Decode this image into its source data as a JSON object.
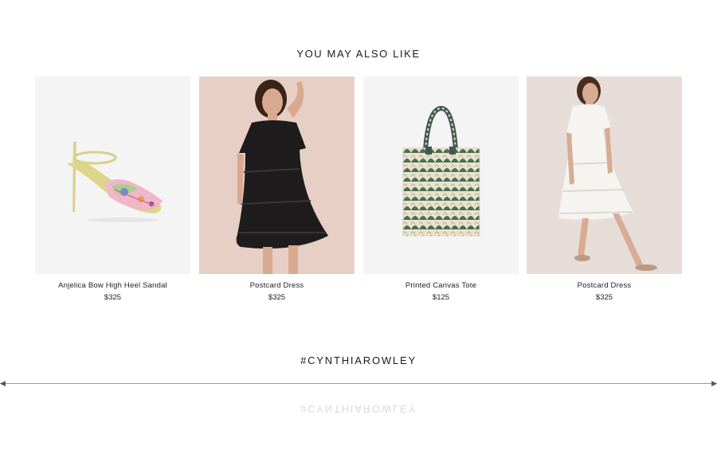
{
  "section": {
    "title": "YOU MAY ALSO LIKE"
  },
  "products": [
    {
      "name": "Anjelica Bow High Heel Sandal",
      "price": "$325",
      "image": "sandal"
    },
    {
      "name": "Postcard Dress",
      "price": "$325",
      "image": "black-dress"
    },
    {
      "name": "Printed Canvas Tote",
      "price": "$125",
      "image": "tote-bag"
    },
    {
      "name": "Postcard Dress",
      "price": "$325",
      "image": "white-dress"
    }
  ],
  "instagram": {
    "hashtag": "#CYNTHIAROWLEY"
  },
  "colors": {
    "image_bg_light": "#f5f5f5",
    "image_bg_pink": "#e6ccc2",
    "text": "#222222"
  }
}
